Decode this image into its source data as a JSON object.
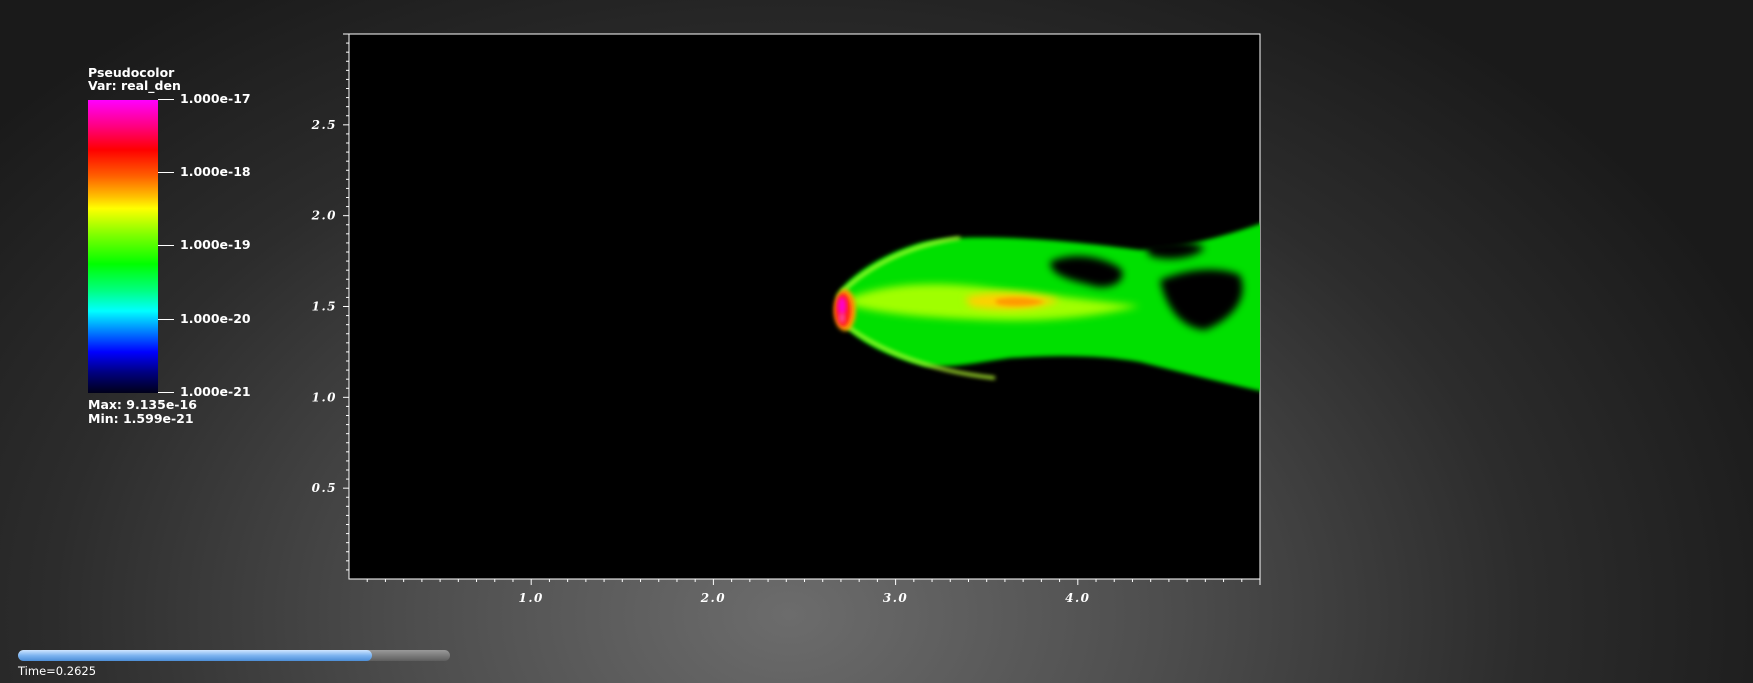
{
  "legend": {
    "title": "Pseudocolor",
    "var_line": "Var: real_den",
    "ticks": [
      "1.000e-17",
      "1.000e-18",
      "1.000e-19",
      "1.000e-20",
      "1.000e-21"
    ],
    "max_line": "Max:  9.135e-16",
    "min_line": "Min:  1.599e-21"
  },
  "time": {
    "label": "Time=0.2625",
    "progress": 0.82
  },
  "chart_data": {
    "type": "heatmap",
    "variable": "real_den",
    "scale": "log",
    "colormap": "hot_desaturated-like rainbow (magenta-red-yellow-green-cyan-blue-black)",
    "xlim": [
      0.0,
      5.0
    ],
    "ylim": [
      0.0,
      3.0
    ],
    "x_ticks": [
      "1.0",
      "2.0",
      "3.0",
      "4.0"
    ],
    "y_ticks": [
      "0.5",
      "1.0",
      "1.5",
      "2.0",
      "2.5"
    ],
    "value_range": {
      "max": 9.135e-16,
      "min": 1.599e-21
    },
    "color_range": [
      1e-21,
      1e-17
    ],
    "features": {
      "bow_head_x": 2.7,
      "bow_head_y": 1.5,
      "tail_end_x": 5.0,
      "tail_upper_y": 1.92,
      "tail_lower_y": 1.03,
      "peak_region": "magenta/red at head near x=2.7, y=1.5"
    },
    "background_color": "#000000",
    "grid": false,
    "legend_position": "left"
  }
}
